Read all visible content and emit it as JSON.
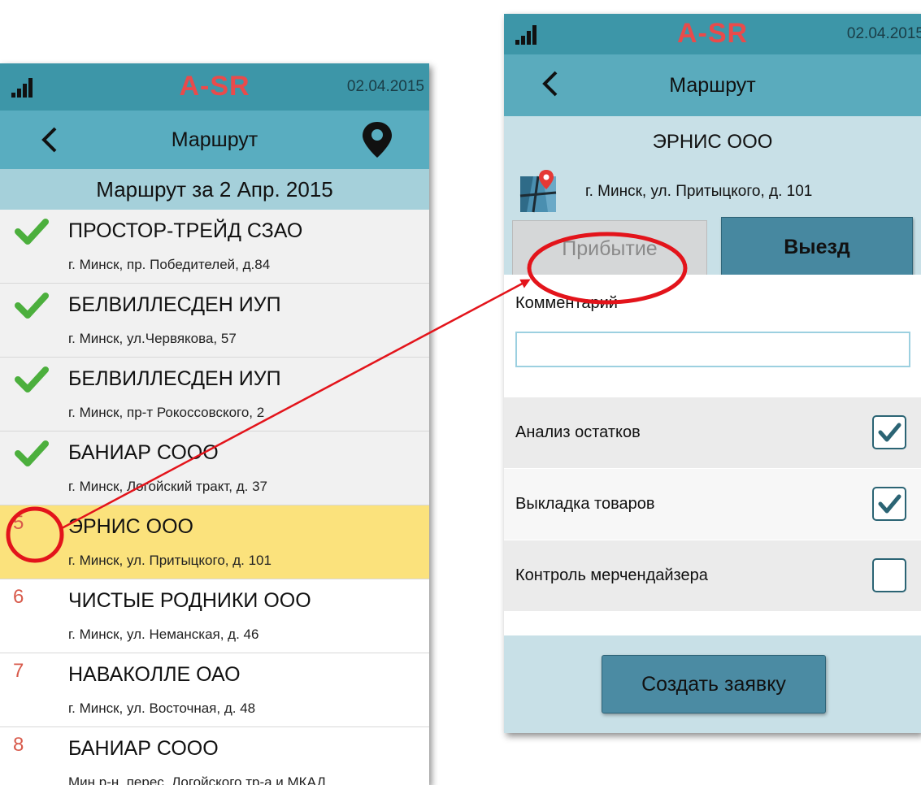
{
  "left_screen": {
    "status_bar": {
      "logo_a": "A",
      "logo_rest": "-SR",
      "date": "02.04.2015"
    },
    "header": {
      "title": "Маршрут"
    },
    "route_date": "Маршрут за 2 Апр. 2015",
    "routes": [
      {
        "status": "done",
        "marker": "",
        "name": "ПРОСТОР-ТРЕЙД СЗАО",
        "address": "г. Минск, пр. Победителей, д.84"
      },
      {
        "status": "done",
        "marker": "",
        "name": "БЕЛВИЛЛЕСДЕН ИУП",
        "address": "г. Минск, ул.Червякова, 57"
      },
      {
        "status": "done",
        "marker": "",
        "name": "БЕЛВИЛЛЕСДЕН ИУП",
        "address": "г. Минск, пр-т Рокоссовского, 2"
      },
      {
        "status": "done",
        "marker": "",
        "name": "БАНИАР СООО",
        "address": "г. Минск, Логойский тракт,  д. 37"
      },
      {
        "status": "active",
        "marker": "5",
        "name": "ЭРНИС ООО",
        "address": "г. Минск, ул. Притыцкого, д. 101"
      },
      {
        "status": "pending",
        "marker": "6",
        "name": "ЧИСТЫЕ РОДНИКИ ООО",
        "address": "г. Минск, ул. Неманская, д. 46"
      },
      {
        "status": "pending",
        "marker": "7",
        "name": "НАВАКОЛЛЕ ОАО",
        "address": "г. Минск, ул. Восточная, д. 48"
      },
      {
        "status": "pending",
        "marker": "8",
        "name": "БАНИАР СООО",
        "address": "Мин  р-н, перес. Логойского тр-а и МКАД,"
      }
    ]
  },
  "right_screen": {
    "status_bar": {
      "logo_a": "A",
      "logo_rest": "-SR",
      "date": "02.04.2015"
    },
    "header": {
      "title": "Маршрут"
    },
    "client": {
      "name": "ЭРНИС ООО",
      "address": "г. Минск, ул. Притыцкого, д. 101"
    },
    "buttons": {
      "arrival": "Прибытие",
      "departure": "Выезд",
      "create_order": "Создать заявку"
    },
    "comment": {
      "label": "Комментарий",
      "value": ""
    },
    "checks": [
      {
        "label": "Анализ остатков",
        "checked": true
      },
      {
        "label": "Выкладка товаров",
        "checked": true
      },
      {
        "label": "Контроль мерчендайзера",
        "checked": false
      }
    ]
  },
  "colors": {
    "status_bar": "#3d96a8",
    "header": "#59adc0",
    "active_row": "#fbe27c",
    "check_green": "#4caf3d",
    "annotation_red": "#e3141b"
  }
}
